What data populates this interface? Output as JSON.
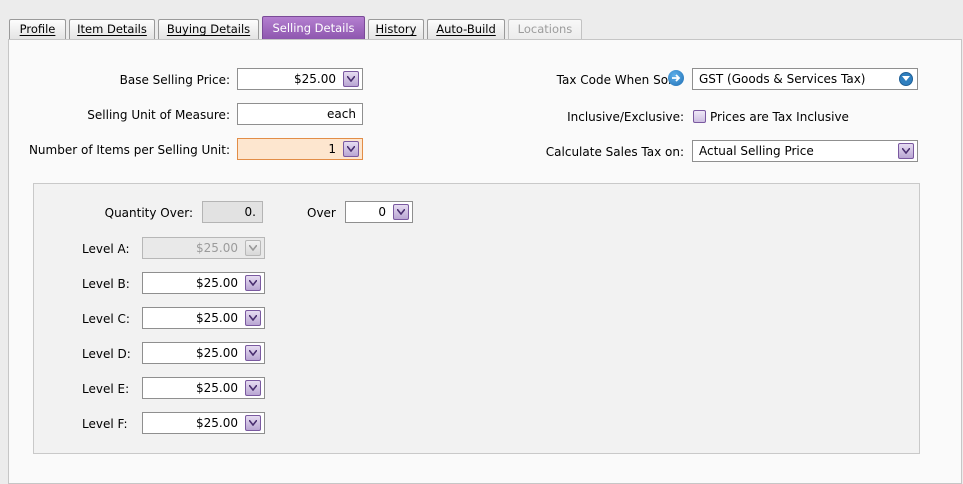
{
  "tabs": [
    {
      "label": "Profile"
    },
    {
      "label": "Item Details"
    },
    {
      "label": "Buying Details"
    },
    {
      "label": "Selling Details"
    },
    {
      "label": "History"
    },
    {
      "label": "Auto-Build"
    },
    {
      "label": "Locations"
    }
  ],
  "form": {
    "base_price_label": "Base Selling Price:",
    "base_price_value": "$25.00",
    "unit_label": "Selling Unit of Measure:",
    "unit_value": "each",
    "items_per_unit_label": "Number of Items per Selling Unit:",
    "items_per_unit_value": "1",
    "tax_code_label": "Tax Code When Sold",
    "tax_code_value": "GST (Goods & Services Tax)",
    "inclusive_label": "Inclusive/Exclusive:",
    "inclusive_checkbox_label": "Prices are Tax Inclusive",
    "calc_label": "Calculate Sales Tax on:",
    "calc_value": "Actual Selling Price"
  },
  "levels": {
    "quantity_over_label": "Quantity Over:",
    "quantity_over_value": "0.",
    "over_label": "Over",
    "over_value": "0",
    "items": [
      {
        "label": "Level A:",
        "value": "$25.00"
      },
      {
        "label": "Level B:",
        "value": "$25.00"
      },
      {
        "label": "Level C:",
        "value": "$25.00"
      },
      {
        "label": "Level D:",
        "value": "$25.00"
      },
      {
        "label": "Level E:",
        "value": "$25.00"
      },
      {
        "label": "Level F:",
        "value": "$25.00"
      }
    ]
  },
  "colors": {
    "active_tab": "#9b62be",
    "highlight_field": "#fde6cf",
    "dropdown_accent": "#7a59a0"
  }
}
